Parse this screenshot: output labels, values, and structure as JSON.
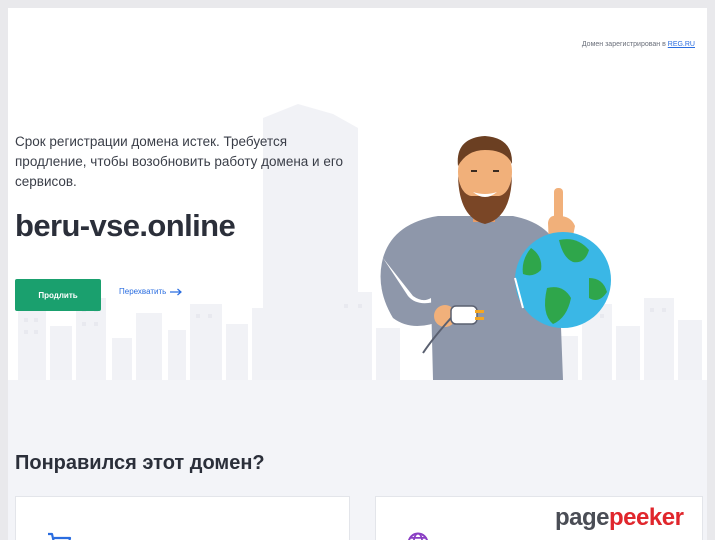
{
  "registrar_note": {
    "text": "Домен зарегистрирован в",
    "link": "REG.RU"
  },
  "hero": {
    "expired_message": "Срок регистрации домена истек. Требуется продление, чтобы возобновить работу домена и его сервисов.",
    "domain_name": "beru-vse.online",
    "renew_button": "Продлить",
    "intercept_link": "Перехватить",
    "intercept_icon": "arrow-right-icon"
  },
  "offer": {
    "question": "Понравился этот домен?",
    "cards": [
      {
        "icon": "cart-icon"
      },
      {
        "icon": "globe-icon"
      }
    ]
  },
  "watermark": {
    "part1": "page",
    "part2": "peeker"
  },
  "colors": {
    "accent_green": "#1aa06e",
    "link_blue": "#2a6de0",
    "text_dark": "#2b2f3a",
    "watermark_red": "#e0262c"
  }
}
